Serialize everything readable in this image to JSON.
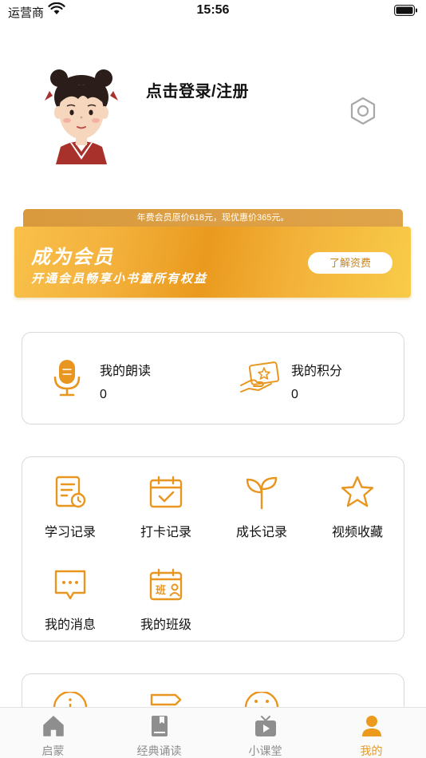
{
  "status_bar": {
    "carrier": "运营商",
    "time": "15:56"
  },
  "profile": {
    "login_text": "点击登录/注册"
  },
  "membership": {
    "price_note": "年费会员原价618元，现优惠价365元。",
    "title": "成为会员",
    "subtitle": "开通会员畅享小书童所有权益",
    "button": "了解资费"
  },
  "stats": [
    {
      "label": "我的朗读",
      "value": "0",
      "icon": "microphone-icon"
    },
    {
      "label": "我的积分",
      "value": "0",
      "icon": "points-card-icon"
    }
  ],
  "menu": [
    {
      "label": "学习记录",
      "icon": "study-record-icon"
    },
    {
      "label": "打卡记录",
      "icon": "calendar-check-icon"
    },
    {
      "label": "成长记录",
      "icon": "sprout-icon"
    },
    {
      "label": "视频收藏",
      "icon": "star-icon"
    },
    {
      "label": "我的消息",
      "icon": "message-icon"
    },
    {
      "label": "我的班级",
      "icon": "class-icon"
    }
  ],
  "tabs": [
    {
      "label": "启蒙",
      "icon": "home-icon",
      "active": false
    },
    {
      "label": "经典诵读",
      "icon": "book-icon",
      "active": false
    },
    {
      "label": "小课堂",
      "icon": "tv-icon",
      "active": false
    },
    {
      "label": "我的",
      "icon": "person-icon",
      "active": true
    }
  ],
  "colors": {
    "accent": "#eb9a1c",
    "icon_orange": "#e8961f",
    "tab_inactive": "#8e8e8e"
  }
}
